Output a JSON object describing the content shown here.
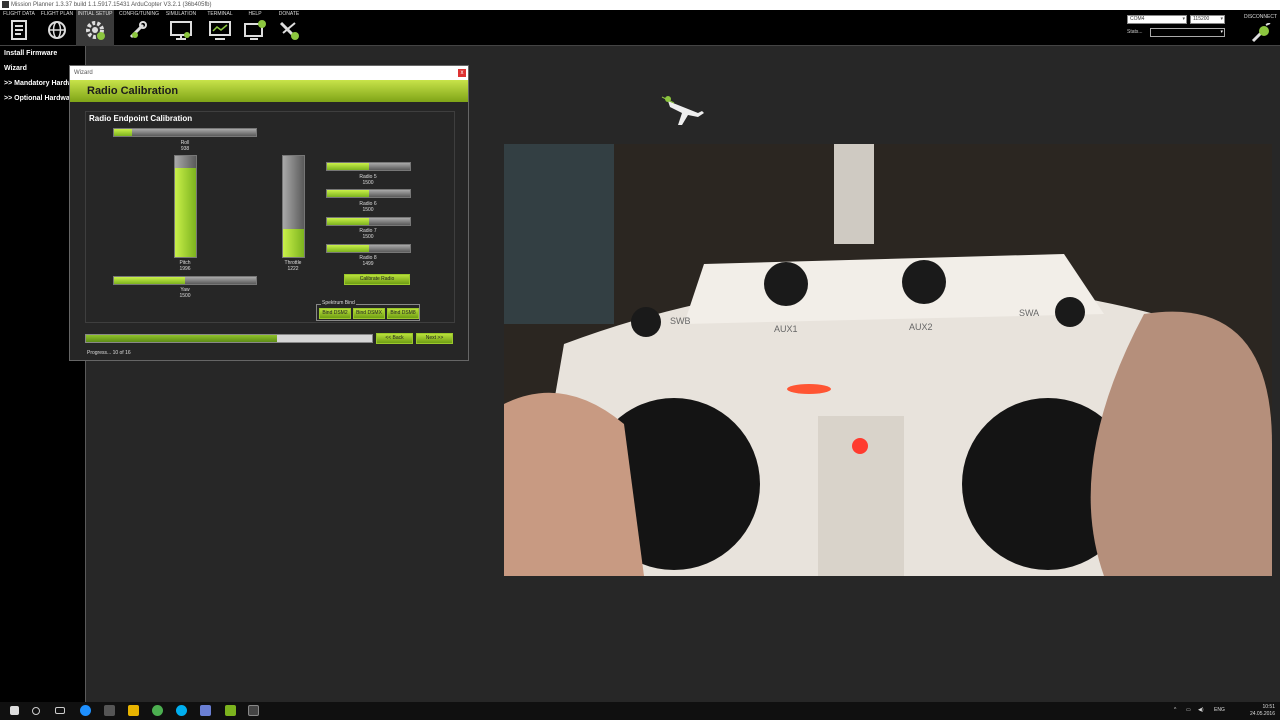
{
  "window": {
    "title": "Mission Planner 1.3.37 build 1.1.5917.15431 ArduCopter V3.2.1 (36b405fb)"
  },
  "menu": {
    "items": [
      {
        "label": "FLIGHT DATA",
        "icon": "flight-data-icon"
      },
      {
        "label": "FLIGHT PLAN",
        "icon": "globe-icon"
      },
      {
        "label": "INITIAL SETUP",
        "icon": "setup-gear-icon"
      },
      {
        "label": "CONFIG/TUNING",
        "icon": "config-tuning-icon"
      },
      {
        "label": "SIMULATION",
        "icon": "monitor-icon"
      },
      {
        "label": "TERMINAL",
        "icon": "terminal-icon"
      },
      {
        "label": "HELP",
        "icon": "help-monitor-icon"
      },
      {
        "label": "DONATE",
        "icon": "donate-plane-icon"
      }
    ],
    "active_index": 2,
    "com_port": "COM4",
    "baud_rate": "115200",
    "stats_label": "Stats...",
    "disconnect_label": "DISCONNECT"
  },
  "left_nav": {
    "items": [
      "Install Firmware",
      "Wizard",
      ">> Mandatory Hardware",
      ">> Optional Hardware"
    ]
  },
  "wizard": {
    "window_title": "Wizard",
    "close_label": "x",
    "banner_title": "Radio Calibration",
    "panel_title": "Radio Endpoint Calibration",
    "channels": {
      "roll": {
        "label": "Roll",
        "value": "938",
        "fill_fraction": 0.13
      },
      "pitch": {
        "label": "Pitch",
        "value": "1996",
        "fill_fraction": 0.88
      },
      "throttle": {
        "label": "Throttle",
        "value": "1222",
        "fill_fraction": 0.28
      },
      "yaw": {
        "label": "Yaw",
        "value": "1500",
        "fill_fraction": 0.5
      },
      "radio5": {
        "label": "Radio 5",
        "value": "1500",
        "fill_fraction": 0.5
      },
      "radio6": {
        "label": "Radio 6",
        "value": "1500",
        "fill_fraction": 0.5
      },
      "radio7": {
        "label": "Radio 7",
        "value": "1500",
        "fill_fraction": 0.5
      },
      "radio8": {
        "label": "Radio 8",
        "value": "1499",
        "fill_fraction": 0.5
      }
    },
    "calibrate_button": "Calibrate Radio",
    "spektrum_bind": {
      "legend": "Spektrum Bind",
      "buttons": [
        "Bind DSM2",
        "Bind DSMX",
        "Bind DSM8"
      ]
    },
    "back_button": "<< Back",
    "next_button": "Next >>",
    "progress_fraction": 0.667,
    "progress_text": "Progress... 10 of 16"
  },
  "video": {
    "transmitter_labels": [
      "SWB",
      "AUX1",
      "AUX2",
      "SWA"
    ]
  },
  "taskbar": {
    "language": "ENG",
    "time": "10:51",
    "date": "24.05.2016"
  }
}
